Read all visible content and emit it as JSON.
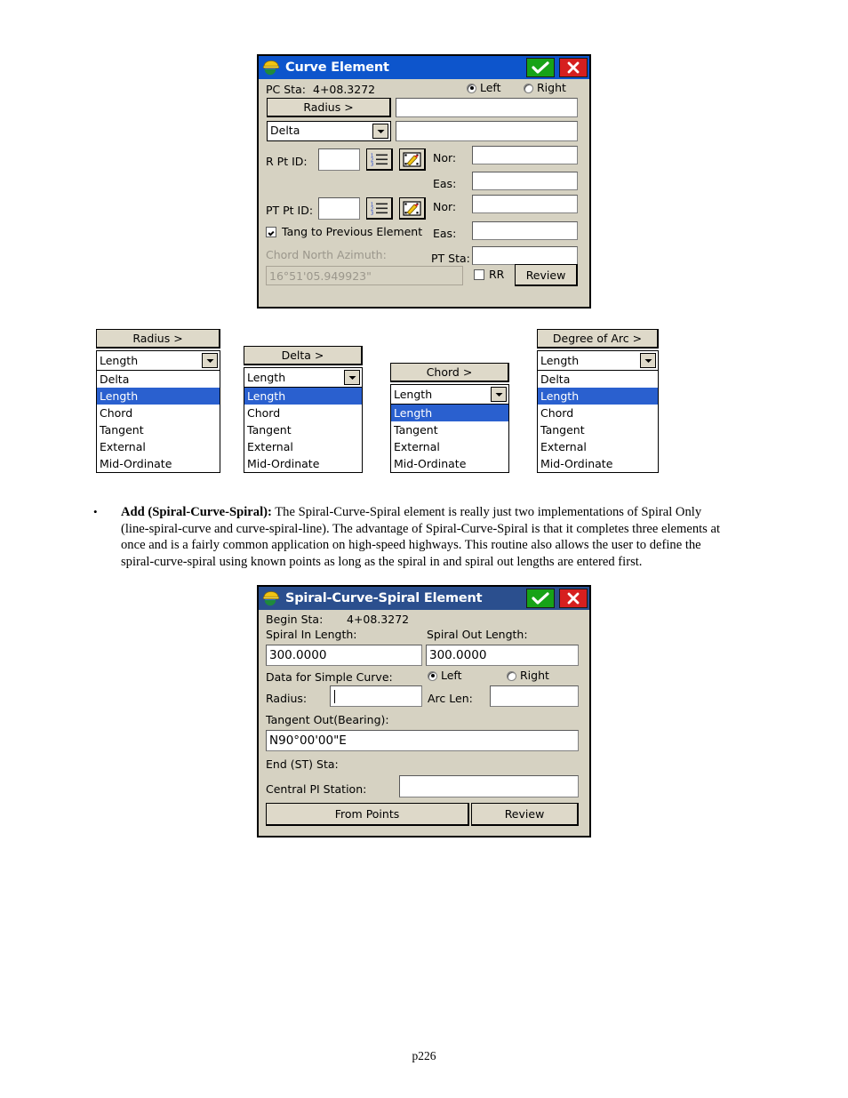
{
  "footer": {
    "page_label": "p226"
  },
  "curve_dialog": {
    "title": "Curve Element",
    "icon": "hardhat-globe-icon",
    "ok_label": "check-icon",
    "close_label": "close-icon",
    "pc_sta_label": "PC Sta:",
    "pc_sta_value": "4+08.3272",
    "side_left_label": "Left",
    "side_right_label": "Right",
    "side_selected": "Left",
    "radius_button": "Radius >",
    "radius_value": "",
    "delta_combo_value": "Delta",
    "delta_value": "",
    "r_pt_id_label": "R Pt ID:",
    "r_pt_id_value": "",
    "pt_pt_id_label": "PT Pt ID:",
    "pt_pt_id_value": "",
    "nor_label": "Nor:",
    "eas_label": "Eas:",
    "r_nor_value": "",
    "r_eas_value": "",
    "pt_nor_value": "",
    "pt_eas_value": "",
    "pt_sta_label": "PT Sta:",
    "pt_sta_value": "",
    "tang_checkbox_label": "Tang to Previous Element",
    "tang_checked": true,
    "chord_azimuth_label": "Chord North Azimuth:",
    "chord_azimuth_value": "16°51'05.949923\"",
    "rr_label": "RR",
    "rr_checked": false,
    "review_label": "Review",
    "list_icon": "numbered-list-icon",
    "pick_icon": "map-pencil-icon"
  },
  "combo_groups": [
    {
      "head": "Radius >",
      "selected": "Length",
      "options": [
        "Delta",
        "Length",
        "Chord",
        "Tangent",
        "External",
        "Mid-Ordinate"
      ],
      "highlighted": "Length"
    },
    {
      "head": "Delta >",
      "selected": "Length",
      "options": [
        "Length",
        "Chord",
        "Tangent",
        "External",
        "Mid-Ordinate"
      ],
      "highlighted": "Length"
    },
    {
      "head": "Chord >",
      "selected": "Length",
      "options": [
        "Length",
        "Tangent",
        "External",
        "Mid-Ordinate"
      ],
      "highlighted": "Length"
    },
    {
      "head": "Degree of Arc >",
      "selected": "Length",
      "options": [
        "Delta",
        "Length",
        "Chord",
        "Tangent",
        "External",
        "Mid-Ordinate"
      ],
      "highlighted": "Length"
    }
  ],
  "paragraph": {
    "bullet": "•",
    "lead": "Add (Spiral-Curve-Spiral):",
    "line1_rest": " The Spiral-Curve-Spiral element is really just two implementations of Spiral Only",
    "line2": "(line-spiral-curve and curve-spiral-line).  The advantage of Spiral-Curve-Spiral is that it completes three elements at",
    "line3": "once and is a fairly common application on high-speed highways. This routine also allows the user to define the",
    "line4": "spiral-curve-spiral using known points as long as the spiral in and spiral out lengths are entered first."
  },
  "scs_dialog": {
    "title": "Spiral-Curve-Spiral Element",
    "icon": "hardhat-globe-icon",
    "ok_label": "check-icon",
    "close_label": "close-icon",
    "begin_sta_label": "Begin Sta:",
    "begin_sta_value": "4+08.3272",
    "spiral_in_label": "Spiral In Length:",
    "spiral_in_value": "300.0000",
    "spiral_out_label": "Spiral Out Length:",
    "spiral_out_value": "300.0000",
    "data_simple_curve_label": "Data for Simple Curve:",
    "side_left_label": "Left",
    "side_right_label": "Right",
    "side_selected": "Left",
    "radius_label": "Radius:",
    "radius_value": "",
    "arc_len_label": "Arc Len:",
    "arc_len_value": "",
    "tangent_out_label": "Tangent Out(Bearing):",
    "tangent_out_value": "N90°00'00\"E",
    "end_st_sta_label": "End (ST) Sta:",
    "end_st_sta_value": "",
    "central_pi_label": "Central PI Station:",
    "central_pi_value": "",
    "from_points_label": "From Points",
    "review_label": "Review"
  }
}
